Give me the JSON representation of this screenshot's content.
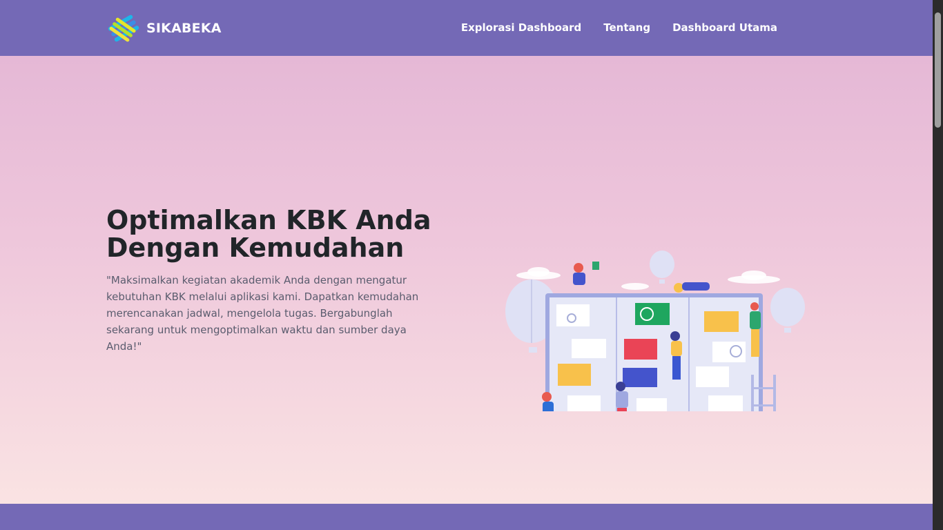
{
  "brand": {
    "name": "SIKABEKA",
    "logo_icon": "sikabeka-logo-icon"
  },
  "nav": {
    "links": [
      {
        "label": "Explorasi Dashboard"
      },
      {
        "label": "Tentang"
      },
      {
        "label": "Dashboard Utama"
      }
    ]
  },
  "hero": {
    "title_line1": "Optimalkan KBK Anda",
    "title_line2": "Dengan Kemudahan",
    "description": "\"Maksimalkan kegiatan akademik Anda dengan mengatur kebutuhan KBK melalui aplikasi kami. Dapatkan kemudahan merencanakan jadwal, mengelola tugas. Bergabunglah sekarang untuk mengoptimalkan waktu dan sumber daya Anda!\"",
    "illustration_icon": "team-kanban-board-illustration"
  },
  "colors": {
    "nav_bg": "#7469b6",
    "hero_gradient_top": "#e5b8d6",
    "hero_gradient_bottom": "#fae3e3",
    "text_dark": "#212529",
    "text_muted": "#5a5c6e"
  }
}
